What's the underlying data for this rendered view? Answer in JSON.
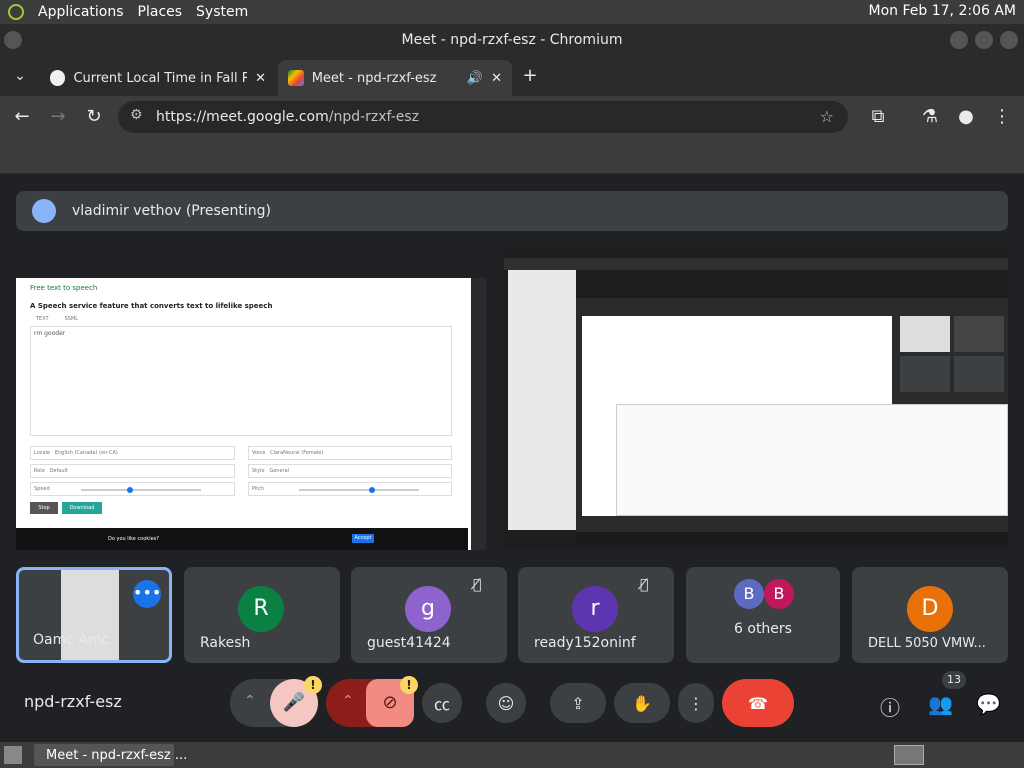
{
  "os": {
    "menu": [
      "Applications",
      "Places",
      "System"
    ],
    "clock": "Mon Feb 17,  2:06 AM"
  },
  "window": {
    "title": "Meet - npd-rzxf-esz - Chromium"
  },
  "tabs": [
    {
      "title": "Current Local Time in Fall Riv",
      "active": false
    },
    {
      "title": "Meet - npd-rzxf-esz",
      "active": true
    }
  ],
  "toolbar": {
    "url_host": "https://meet.google.com",
    "url_path": "/npd-rzxf-esz"
  },
  "meet": {
    "presenting": "vladimir vethov (Presenting)",
    "screen1": {
      "app_title": "Free text to speech",
      "headline": "A Speech service feature that converts text to lifelike speech",
      "tabs": [
        "TEXT",
        "SSML"
      ],
      "content": "rm gooder",
      "locale_label": "Locale",
      "locale_value": "English (Canada) (en-CA)",
      "voice_label": "Voice",
      "voice_value": "ClaraNeural (Female)",
      "role_label": "Role",
      "role_value": "Default",
      "style_label": "Style",
      "style_value": "General",
      "speed_label": "Speed",
      "pitch_label": "Pitch",
      "stop_label": "Stop",
      "download_label": "Download",
      "cookie_prompt": "Do you like cookies?",
      "cookie_btn": "Accept"
    },
    "participants": [
      {
        "name": "Oamc Amc",
        "type": "video",
        "muted": false,
        "color": ""
      },
      {
        "name": "Rakesh",
        "initial": "R",
        "color": "#0b8043",
        "muted": false
      },
      {
        "name": "guest41424",
        "initial": "g",
        "color": "#8e63ce",
        "muted": true
      },
      {
        "name": "ready152oninf",
        "initial": "r",
        "color": "#5e35b1",
        "muted": true
      },
      {
        "name": "6 others",
        "initials": [
          "B",
          "B"
        ],
        "colors": [
          "#5c6bc0",
          "#c2185b"
        ]
      },
      {
        "name": "DELL 5050 VMW...",
        "initial": "D",
        "color": "#e8710a",
        "muted": false
      }
    ],
    "meeting_code": "npd-rzxf-esz",
    "people_count": "13",
    "warning_glyph": "!"
  },
  "taskbar": {
    "item": "Meet - npd-rzxf-esz ..."
  }
}
